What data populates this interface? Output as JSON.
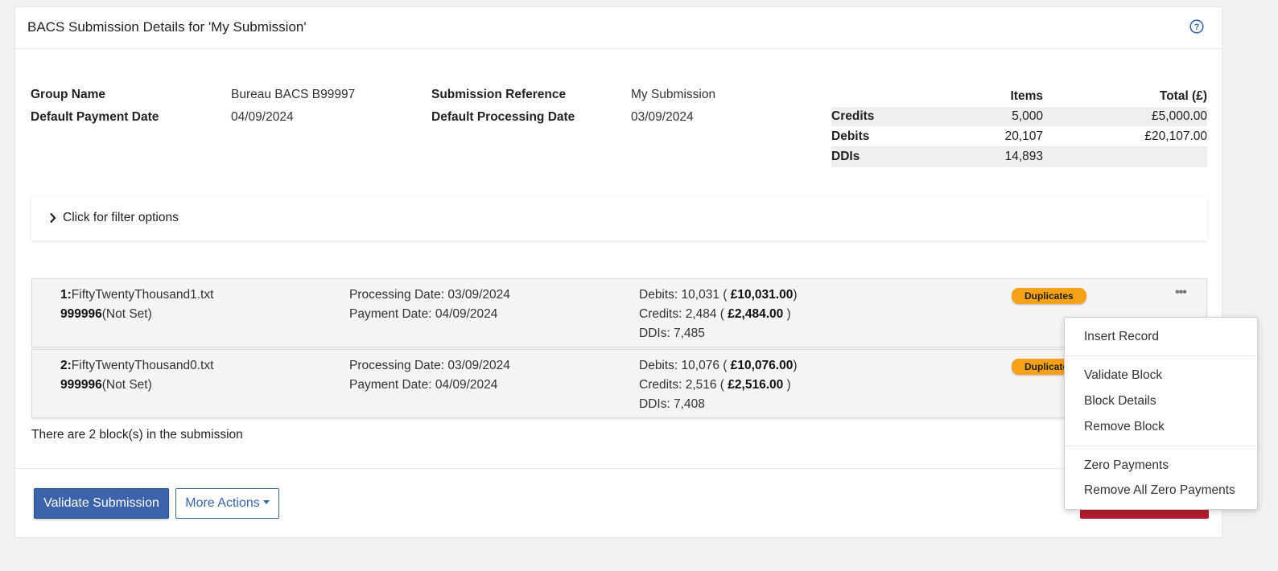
{
  "header": {
    "title": "BACS Submission Details for 'My Submission'",
    "help_icon": "question-circle-icon"
  },
  "details": {
    "group_name_label": "Group Name",
    "group_name_value": "Bureau BACS B99997",
    "payment_date_label": "Default Payment Date",
    "payment_date_value": "04/09/2024",
    "submission_ref_label": "Submission Reference",
    "submission_ref_value": "My Submission",
    "processing_date_label": "Default Processing Date",
    "processing_date_value": "03/09/2024"
  },
  "totals": {
    "headers": {
      "items": "Items",
      "total": "Total (£)"
    },
    "rows": [
      {
        "label": "Credits",
        "items": "5,000",
        "total": "£5,000.00"
      },
      {
        "label": "Debits",
        "items": "20,107",
        "total": "£20,107.00"
      },
      {
        "label": "DDIs",
        "items": "14,893",
        "total": ""
      }
    ]
  },
  "filter": {
    "label": "Click for filter options",
    "icon": "chevron-right-icon"
  },
  "blocks": [
    {
      "index": "1:",
      "filename": "FiftyTwentyThousand1.txt",
      "sun": "999996",
      "sun_note": "(Not Set)",
      "processing": "Processing Date: 03/09/2024",
      "payment": "Payment Date: 04/09/2024",
      "debits_prefix": "Debits: 10,031 ( ",
      "debits_amount": "£10,031.00",
      "debits_suffix": ")",
      "credits_prefix": "Credits: 2,484 ( ",
      "credits_amount": "£2,484.00",
      "credits_suffix": " )",
      "ddis": "DDIs: 7,485",
      "badge": "Duplicates",
      "menu_icon": "•••"
    },
    {
      "index": "2:",
      "filename": "FiftyTwentyThousand0.txt",
      "sun": "999996",
      "sun_note": "(Not Set)",
      "processing": "Processing Date: 03/09/2024",
      "payment": "Payment Date: 04/09/2024",
      "debits_prefix": "Debits: 10,076 ( ",
      "debits_amount": "£10,076.00",
      "debits_suffix": ")",
      "credits_prefix": "Credits: 2,516 ( ",
      "credits_amount": "£2,516.00",
      "credits_suffix": " )",
      "ddis": "DDIs: 7,408",
      "badge": "Duplicate"
    }
  ],
  "summary": "There are 2 block(s) in the submission",
  "footer": {
    "validate_label": "Validate Submission",
    "more_actions_label": "More Actions"
  },
  "context_menu": {
    "insert_record": "Insert Record",
    "validate_block": "Validate Block",
    "block_details": "Block Details",
    "remove_block": "Remove Block",
    "zero_payments": "Zero Payments",
    "remove_all_zero": "Remove All Zero Payments"
  },
  "colors": {
    "primary": "#3c64a8",
    "badge": "#f7a11a",
    "danger": "#b31b2c"
  }
}
